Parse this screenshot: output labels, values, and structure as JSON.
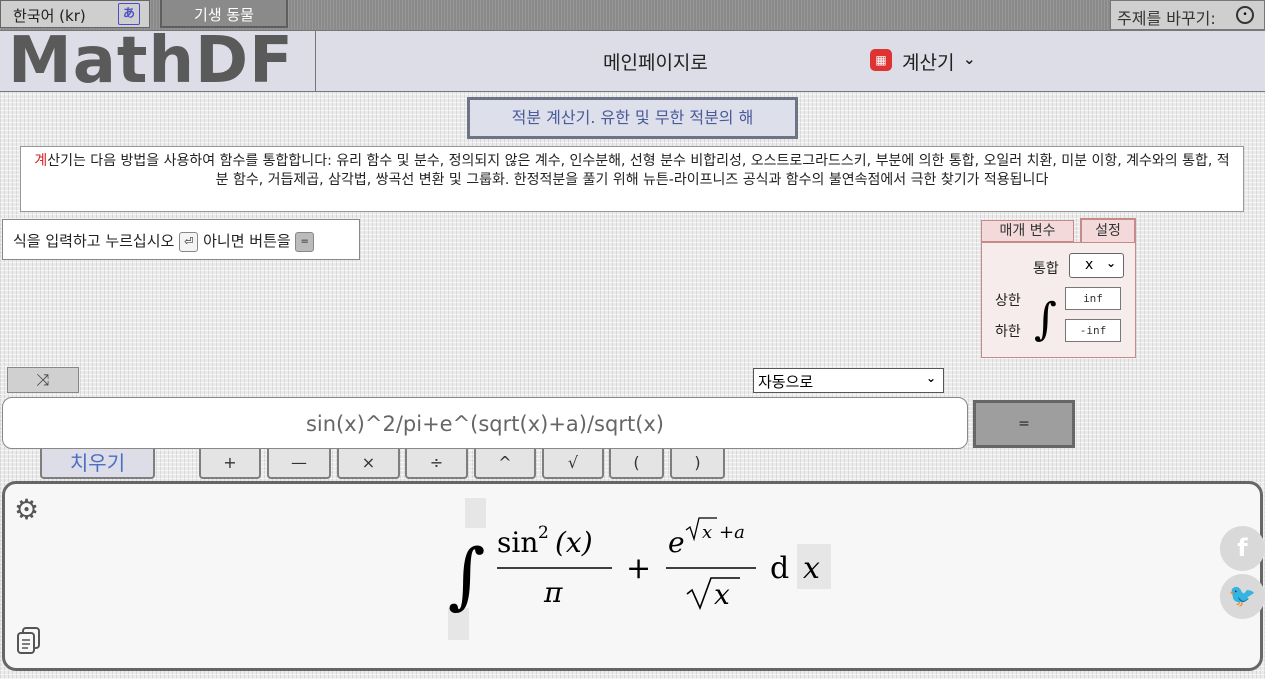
{
  "topbar": {
    "language": "한국어 (kr)",
    "theme_name": "기생 동물",
    "theme_switch_label": "주제를 바꾸기:"
  },
  "header": {
    "logo": "MathDF",
    "nav_home": "메인페이지로",
    "nav_calculators": "계산기"
  },
  "page_title": "적분 계산기. 유한 및 무한 적분의 해",
  "description": {
    "first_char": "계",
    "text": "산기는 다음 방법을 사용하여 함수를 통합합니다: 유리 함수 및 분수, 정의되지 않은 계수, 인수분해, 선형 분수 비합리성, 오스트로그라드스키, 부분에 의한 통합, 오일러 치환, 미분 이항, 계수와의 통합, 적분 함수, 거듭제곱, 삼각법, 쌍곡선 변환 및 그룹화. 한정적분을 풀기 위해 뉴튼-라이프니즈 공식과 함수의 불연속점에서 극한 찾기가 적용됩니다"
  },
  "instruction": {
    "before": "식을 입력하고 누르십시오",
    "enter_key": "⏎",
    "middle": "아니면 버튼을",
    "equals_key": "="
  },
  "settings_panel": {
    "tab_params": "매개 변수",
    "tab_settings": "설정",
    "integrate_label": "통합",
    "variable": "x",
    "upper_label": "상한",
    "lower_label": "하한",
    "upper_value": "inf",
    "lower_value": "-inf"
  },
  "mode_select": "자동으로",
  "expression": "sin(x)^2/pi+e^(sqrt(x)+a)/sqrt(x)",
  "equals_button": "=",
  "clear_button": "치우기",
  "keys": [
    "+",
    "—",
    "×",
    "÷",
    "^",
    "√",
    "(",
    ")"
  ],
  "result": {
    "integral_sign": "∫",
    "term1_num_func": "sin",
    "term1_num_power": "2",
    "term1_num_arg": "(x)",
    "term1_den": "π",
    "plus": "+",
    "term2_base": "e",
    "term2_exp_var": "x",
    "term2_exp_rest": "+a",
    "term2_den_var": "x",
    "d": "d",
    "var": "x"
  },
  "icons": {
    "translate": "translate-icon",
    "theme": "palette-icon",
    "calculator": "calculator-icon",
    "shuffle": "shuffle-icon",
    "gear": "gear-icon",
    "copy": "copy-icon",
    "facebook": "facebook-icon",
    "twitter": "twitter-icon"
  }
}
